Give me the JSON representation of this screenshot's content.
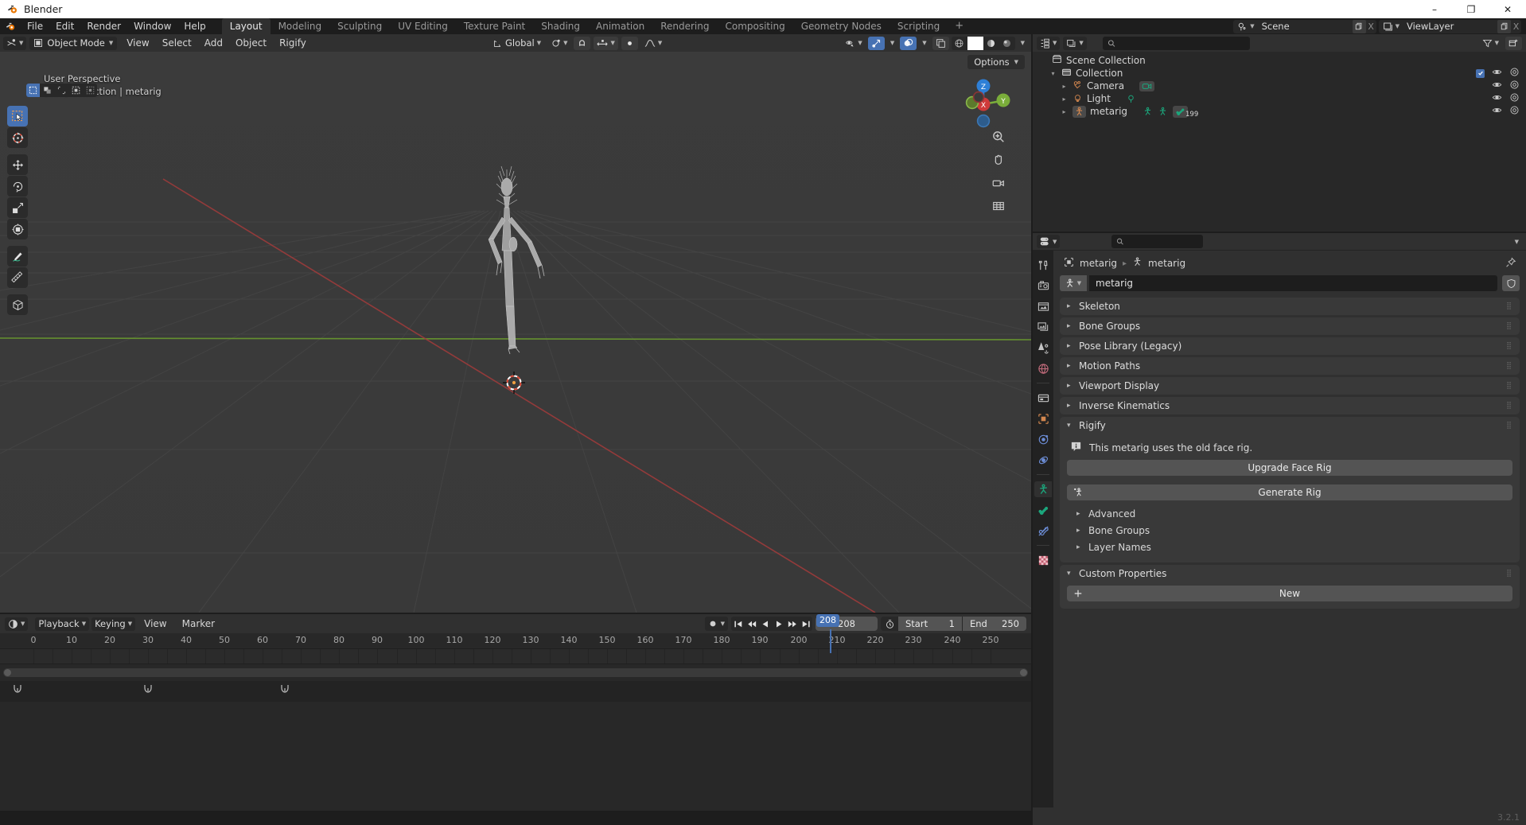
{
  "window": {
    "title": "Blender",
    "minimize": "–",
    "maximize": "❐",
    "close": "✕",
    "version": "3.2.1"
  },
  "topbar": {
    "menus": [
      "File",
      "Edit",
      "Render",
      "Window",
      "Help"
    ],
    "workspaces": [
      {
        "label": "Layout",
        "active": true
      },
      {
        "label": "Modeling",
        "active": false
      },
      {
        "label": "Sculpting",
        "active": false
      },
      {
        "label": "UV Editing",
        "active": false
      },
      {
        "label": "Texture Paint",
        "active": false
      },
      {
        "label": "Shading",
        "active": false
      },
      {
        "label": "Animation",
        "active": false
      },
      {
        "label": "Rendering",
        "active": false
      },
      {
        "label": "Compositing",
        "active": false
      },
      {
        "label": "Geometry Nodes",
        "active": false
      },
      {
        "label": "Scripting",
        "active": false
      }
    ],
    "add_workspace": "+",
    "scene_name": "Scene",
    "viewlayer_name": "ViewLayer",
    "new_copy": "copy-icon",
    "unlink": "X"
  },
  "viewport": {
    "mode": "Object Mode",
    "menus": [
      "View",
      "Select",
      "Add",
      "Object",
      "Rigify"
    ],
    "transform_orientation": "Global",
    "overlay_text_line1": "User Perspective",
    "overlay_text_line2": "(208) Collection | metarig",
    "options_label": "Options",
    "gizmo_axes": {
      "x": "X",
      "y": "Y",
      "z": "Z"
    },
    "select_modes": [
      "tweak",
      "box-select",
      "circle-select",
      "lasso-select",
      "select-extend"
    ],
    "tools": [
      {
        "name": "tweak-tool",
        "active": true
      },
      {
        "name": "cursor-tool",
        "active": false
      },
      {
        "name": "move-tool",
        "active": false
      },
      {
        "name": "rotate-tool",
        "active": false
      },
      {
        "name": "scale-tool",
        "active": false
      },
      {
        "name": "transform-tool",
        "active": false
      },
      {
        "name": "annotate-tool",
        "active": false
      },
      {
        "name": "measure-tool",
        "active": false
      },
      {
        "name": "add-cube-tool",
        "active": false
      }
    ],
    "shading_modes": [
      "wireframe",
      "solid",
      "material-preview",
      "rendered"
    ],
    "active_shading": "solid"
  },
  "outliner": {
    "search_placeholder": "",
    "rows": [
      {
        "label": "Scene Collection",
        "icon": "scene-collection-icon",
        "indent": 0,
        "disclosure": "",
        "checkbox": false,
        "eye": false,
        "camera": false
      },
      {
        "label": "Collection",
        "icon": "collection-icon",
        "indent": 1,
        "disclosure": "▾",
        "checkbox": true,
        "eye": true,
        "camera": true
      },
      {
        "label": "Camera",
        "icon": "camera-object-icon",
        "indent": 2,
        "disclosure": "▸",
        "checkbox": false,
        "eye": true,
        "camera": true
      },
      {
        "label": "Light",
        "icon": "light-object-icon",
        "indent": 2,
        "disclosure": "▸",
        "checkbox": false,
        "eye": true,
        "camera": true
      },
      {
        "label": "metarig",
        "icon": "armature-object-icon",
        "indent": 2,
        "disclosure": "▸",
        "checkbox": false,
        "eye": true,
        "camera": true,
        "bone_count": "199"
      }
    ]
  },
  "properties": {
    "search_placeholder": "",
    "breadcrumb": [
      {
        "label": "metarig",
        "icon": "object-icon"
      },
      {
        "label": "metarig",
        "icon": "armature-data-icon"
      }
    ],
    "datablock_name": "metarig",
    "tabs": [
      {
        "name": "tool-tab",
        "active": false
      },
      {
        "name": "render-tab",
        "active": false
      },
      {
        "name": "output-tab",
        "active": false
      },
      {
        "name": "view-layer-tab",
        "active": false
      },
      {
        "name": "scene-tab",
        "active": false
      },
      {
        "name": "world-tab",
        "active": false
      },
      {
        "name": "collection-tab",
        "active": false
      },
      {
        "name": "object-tab",
        "active": false
      },
      {
        "name": "modifiers-tab",
        "active": false
      },
      {
        "name": "physics-tab",
        "active": false
      },
      {
        "name": "object-data-armature-tab",
        "active": true
      },
      {
        "name": "bone-tab",
        "active": false
      },
      {
        "name": "bone-constraint-tab",
        "active": false
      },
      {
        "name": "texture-tab",
        "active": false
      }
    ],
    "panels": [
      {
        "label": "Skeleton",
        "open": false
      },
      {
        "label": "Bone Groups",
        "open": false
      },
      {
        "label": "Pose Library (Legacy)",
        "open": false
      },
      {
        "label": "Motion Paths",
        "open": false
      },
      {
        "label": "Viewport Display",
        "open": false
      },
      {
        "label": "Inverse Kinematics",
        "open": false
      }
    ],
    "rigify": {
      "label": "Rigify",
      "open": true,
      "info_message": "This metarig uses the old face rig.",
      "upgrade_button": "Upgrade Face Rig",
      "generate_button": "Generate Rig",
      "subpanels": [
        "Advanced",
        "Bone Groups",
        "Layer Names"
      ]
    },
    "custom_properties": {
      "label": "Custom Properties",
      "open": true,
      "new_button": "New"
    }
  },
  "timeline": {
    "menus": [
      "Playback",
      "Keying",
      "View",
      "Marker"
    ],
    "current_frame": "208",
    "start_label": "Start",
    "start_value": "1",
    "end_label": "End",
    "end_value": "250",
    "ruler_ticks": [
      "0",
      "10",
      "20",
      "30",
      "40",
      "50",
      "60",
      "70",
      "80",
      "90",
      "100",
      "110",
      "120",
      "130",
      "140",
      "150",
      "160",
      "170",
      "180",
      "190",
      "200",
      "210",
      "220",
      "230",
      "240",
      "250"
    ],
    "playhead_label": "208",
    "transport": [
      "jump-to-start",
      "jump-prev-keyframe",
      "play-reverse",
      "play",
      "jump-next-keyframe",
      "jump-to-end"
    ]
  },
  "colors": {
    "accent": "#4772b3",
    "bg_dark": "#1d1d1d",
    "bg_panel": "#303030",
    "bg_editor": "#282828",
    "viewport": "#393939",
    "axis_x": "#a33b3b",
    "axis_y": "#6a9b2e",
    "green_icon": "#1ba67c",
    "orange_icon": "#d3874f"
  }
}
